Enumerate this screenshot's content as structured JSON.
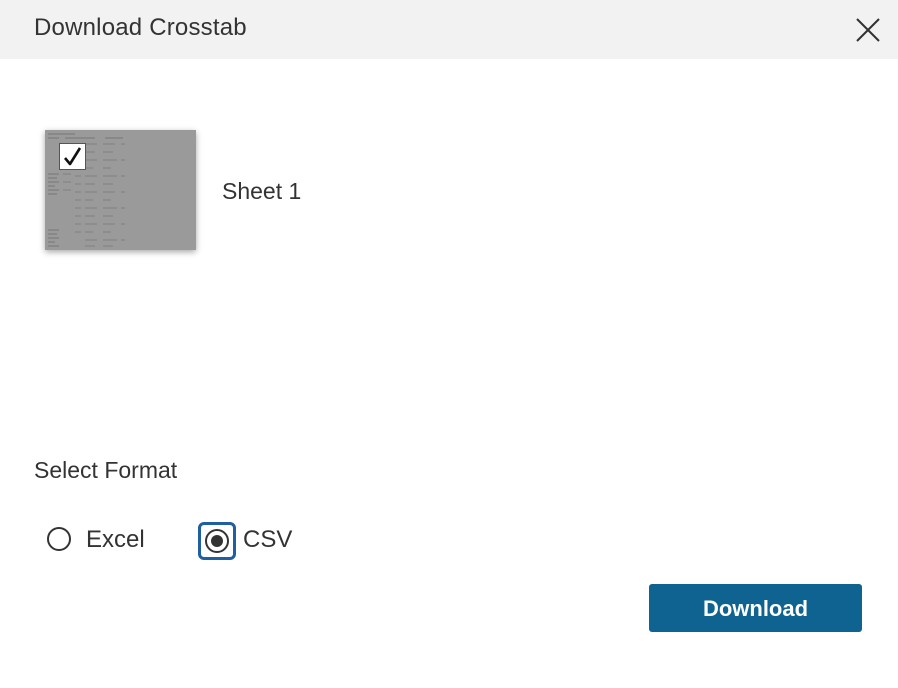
{
  "dialog": {
    "title": "Download Crosstab",
    "close_icon": "close-icon"
  },
  "sheets": [
    {
      "label": "Sheet 1",
      "selected": true,
      "check_icon": "checkmark-icon"
    }
  ],
  "format": {
    "label": "Select Format",
    "options": [
      {
        "label": "Excel",
        "selected": false
      },
      {
        "label": "CSV",
        "selected": true
      }
    ]
  },
  "actions": {
    "download_label": "Download"
  },
  "colors": {
    "header_bg": "#f2f2f2",
    "primary_button": "#0f6390",
    "focus_ring": "#1f5fa0",
    "thumbnail_bg": "#9a9a9a"
  }
}
